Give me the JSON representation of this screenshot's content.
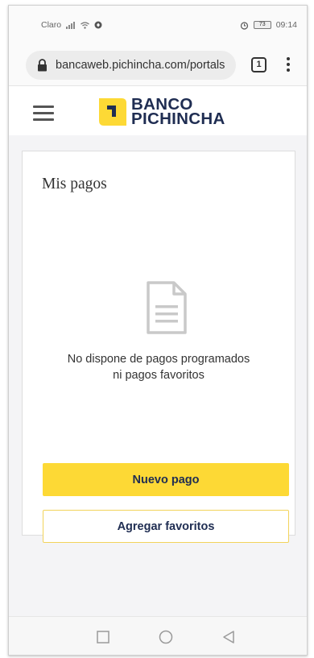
{
  "status_bar": {
    "carrier": "Claro",
    "time": "09:14",
    "battery": "73"
  },
  "browser": {
    "url": "bancaweb.pichincha.com/portals",
    "tab_count": "1"
  },
  "brand": {
    "line1": "BANCO",
    "line2": "PICHINCHA",
    "primary_color": "#1f2d52",
    "accent_color": "#fdd935"
  },
  "page": {
    "title": "Mis pagos",
    "empty_line1": "No dispone de pagos programados",
    "empty_line2": "ni pagos favoritos",
    "primary_button": "Nuevo pago",
    "secondary_button": "Agregar favoritos"
  },
  "icons": {
    "lock": "lock-icon",
    "document": "document-icon",
    "menu": "hamburger-menu-icon",
    "more": "more-vert-icon",
    "nav_recents": "recents-square-icon",
    "nav_home": "home-circle-icon",
    "nav_back": "back-triangle-icon"
  }
}
